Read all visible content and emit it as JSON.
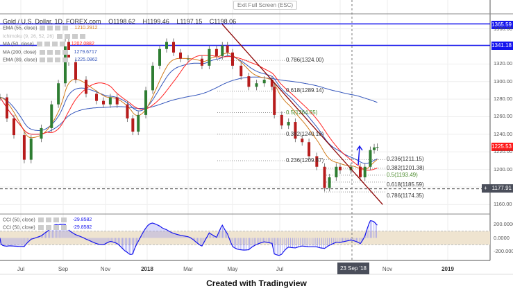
{
  "header": {
    "symbol": "Gold / U.S. Dollar, 1D, FOREX.com",
    "open": "O1198.62",
    "high": "H1199.46",
    "low": "L1197.15",
    "close": "C1198.06",
    "exit_fullscreen": "Exit Full Screen (ESC)"
  },
  "indicators": [
    {
      "label": "EMA (55, close)",
      "value": "1210.2912",
      "color": "#d07a1a"
    },
    {
      "label": "Ichimoku (9, 26, 52, 26)",
      "value": "",
      "color": "#bbbbbb"
    },
    {
      "label": "MA (50, close)",
      "value": "1202.0882",
      "color": "#ff2020"
    },
    {
      "label": "MA (200, close)",
      "value": "1279.6717",
      "color": "#3355bb"
    },
    {
      "label": "EMA (89, close)",
      "value": "1225.0862",
      "color": "#3355bb"
    }
  ],
  "cci_legend": [
    {
      "label": "CCI (50, close)",
      "value": "-29.8582"
    },
    {
      "label": "CCI (50, close)",
      "value": "-29.8582"
    }
  ],
  "price_axis": {
    "ticks": [
      "1360.00",
      "1320.00",
      "1300.00",
      "1280.00",
      "1260.00",
      "1240.00",
      "1220.00",
      "1200.00",
      "1160.00"
    ],
    "tick_values": [
      1360,
      1320,
      1300,
      1280,
      1260,
      1240,
      1220,
      1200,
      1160
    ]
  },
  "cci_axis": {
    "ticks": [
      "200.0000",
      "0.0000",
      "-200.0000"
    ],
    "tick_values": [
      200,
      0,
      -200
    ]
  },
  "time_axis": [
    {
      "label": "Jul",
      "date": "2017-07-01"
    },
    {
      "label": "Sep",
      "date": "2017-09-01"
    },
    {
      "label": "Nov",
      "date": "2017-11-01"
    },
    {
      "label": "2018",
      "date": "2018-01-01"
    },
    {
      "label": "Mar",
      "date": "2018-03-01"
    },
    {
      "label": "May",
      "date": "2018-05-01"
    },
    {
      "label": "Jul",
      "date": "2018-07-01"
    },
    {
      "label": "Nov",
      "date": "2018-11-01"
    },
    {
      "label": "2019",
      "date": "2019-01-01"
    }
  ],
  "crosshair_date": "23 Sep '18",
  "price_tags": {
    "last": "1225.53",
    "last_color": "#ff0000",
    "level1": "1365.59",
    "level2": "1341.18",
    "cursor": "1177.91"
  },
  "fib_left": [
    "0.786(1324.00)",
    "0.618(1289.14)",
    "0.5(1264.65)",
    "0.382(1240.16)",
    "0.236(1209.87)"
  ],
  "fib_left_values": [
    1324.0,
    1289.14,
    1264.65,
    1240.16,
    1209.87
  ],
  "fib_right": [
    "0.236(1211.15)",
    "0.382(1201.38)",
    "0.5(1193.49)",
    "0.618(1185.59)",
    "0.786(1174.35)"
  ],
  "fib_right_values": [
    1211.15,
    1201.38,
    1193.49,
    1185.59,
    1174.35
  ],
  "caption": "Created with Tradingview",
  "chart_data": {
    "type": "candlestick",
    "ylim": [
      1150,
      1377
    ],
    "cci_ylim": [
      -330,
      320
    ],
    "horizontal_lines": [
      1365.59,
      1341.18,
      1177.91
    ],
    "trendline": [
      {
        "date": "2018-04-17",
        "price": 1365
      },
      {
        "date": "2018-10-26",
        "price": 1160
      }
    ],
    "x": [
      "2017-06-01",
      "2017-06-11",
      "2017-06-21",
      "2017-07-06",
      "2017-07-16",
      "2017-07-31",
      "2017-08-15",
      "2017-08-25",
      "2017-09-04",
      "2017-09-09",
      "2017-09-19",
      "2017-10-04",
      "2017-10-19",
      "2017-10-29",
      "2017-11-08",
      "2017-11-18",
      "2017-12-03",
      "2017-12-11",
      "2017-12-19",
      "2017-12-30",
      "2018-01-09",
      "2018-01-19",
      "2018-01-29",
      "2018-02-08",
      "2018-02-18",
      "2018-03-01",
      "2018-03-20",
      "2018-03-30",
      "2018-04-09",
      "2018-04-17",
      "2018-04-24",
      "2018-05-01",
      "2018-05-12",
      "2018-05-22",
      "2018-06-01",
      "2018-06-11",
      "2018-06-21",
      "2018-06-24",
      "2018-07-03",
      "2018-07-10",
      "2018-07-17",
      "2018-07-24",
      "2018-07-31",
      "2018-08-08",
      "2018-08-16",
      "2018-08-21",
      "2018-08-28",
      "2018-09-01",
      "2018-09-15",
      "2018-09-27",
      "2018-10-03",
      "2018-10-10",
      "2018-10-15",
      "2018-10-19"
    ],
    "close": [
      1282,
      1258,
      1239,
      1211,
      1235,
      1247,
      1274,
      1298,
      1345,
      1322,
      1302,
      1286,
      1278,
      1274,
      1282,
      1274,
      1258,
      1243,
      1262,
      1290,
      1318,
      1337,
      1345,
      1333,
      1326,
      1326,
      1318,
      1337,
      1329,
      1341,
      1333,
      1318,
      1306,
      1294,
      1298,
      1302,
      1294,
      1262,
      1250,
      1254,
      1235,
      1231,
      1215,
      1203,
      1179,
      1191,
      1203,
      1199,
      1203,
      1191,
      1203,
      1222,
      1225,
      1225.53
    ]
  }
}
